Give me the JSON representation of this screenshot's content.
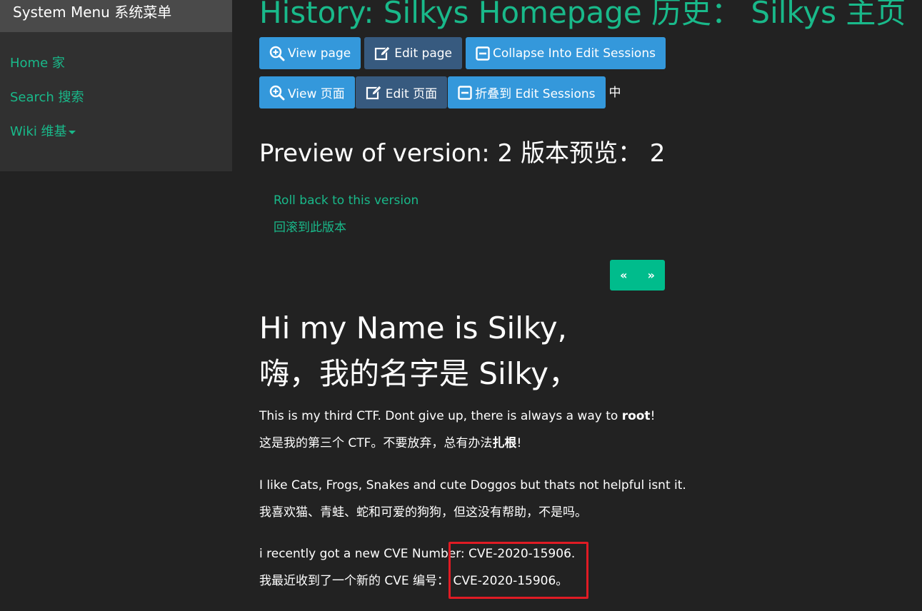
{
  "sidebar": {
    "title": "System Menu  系统菜单",
    "items": [
      {
        "label": "Home  家"
      },
      {
        "label": "Search  搜索"
      },
      {
        "label": "Wiki  维基"
      }
    ]
  },
  "page": {
    "title": "History: Silkys Homepage  历史：  Silkys 主页"
  },
  "toolbar_en": {
    "view": "View page",
    "edit": "Edit page",
    "collapse": "Collapse Into Edit Sessions"
  },
  "toolbar_zh": {
    "view": "View 页面",
    "edit": "Edit 页面",
    "collapse": "折叠到 Edit Sessions",
    "suffix": "中"
  },
  "preview": {
    "heading": "Preview of version: 2  版本预览：  2",
    "rollback_en": "Roll back to this version",
    "rollback_zh": "回滚到此版本"
  },
  "pager": {
    "prev": "«",
    "next": "»"
  },
  "content": {
    "heading_en": "Hi my Name is Silky,",
    "heading_zh": "嗨，我的名字是 Silky，",
    "p1_en_pre": "This is my third CTF. Dont give up, there is always a way to ",
    "p1_en_bold": "root",
    "p1_en_post": "!",
    "p1_zh_pre": "这是我的第三个 CTF。不要放弃，总有办法",
    "p1_zh_bold": "扎根",
    "p1_zh_post": "!",
    "p2_en": "I like Cats, Frogs, Snakes and cute Doggos but thats not helpful isnt it.",
    "p2_zh": "我喜欢猫、青蛙、蛇和可爱的狗狗，但这没有帮助，不是吗。",
    "p3_en": "i recently got a new CVE Number: CVE-2020-15906.",
    "p3_zh": "我最近收到了一个新的 CVE 编号：  CVE-2020-15906。"
  },
  "colors": {
    "accent": "#19b98a",
    "background": "#222222",
    "btn_blue": "#3498db",
    "btn_slate": "#375a7f",
    "highlight": "#e01b24"
  }
}
